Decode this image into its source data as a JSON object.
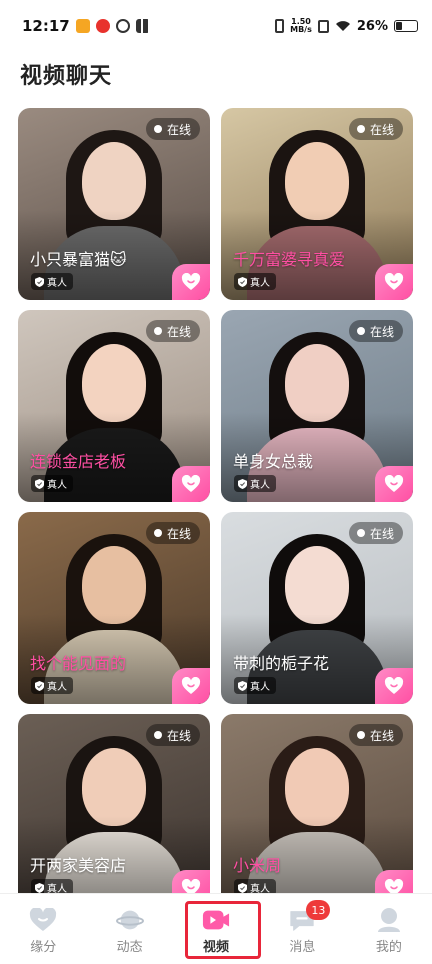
{
  "status_bar": {
    "time": "12:17",
    "net_speed_value": "1.50",
    "net_speed_unit": "MB/s",
    "battery": "26%"
  },
  "page_title": "视频聊天",
  "cards": [
    {
      "name": "小只暴富猫🐱",
      "name_color": "white",
      "status": "在线",
      "verified": "真人",
      "photo": {
        "bg1": "#9a8b80",
        "bg2": "#5a4e47",
        "hair": "#1e1714",
        "skin": "#efd3c2",
        "top": "#6b6b6b"
      }
    },
    {
      "name": "千万富婆寻真爱",
      "name_color": "pink",
      "status": "在线",
      "verified": "真人",
      "photo": {
        "bg1": "#d6c7a4",
        "bg2": "#8f7a58",
        "hair": "#1b1411",
        "skin": "#f1cdb4",
        "top": "#a56b6e"
      }
    },
    {
      "name": "连锁金店老板",
      "name_color": "pink",
      "status": "在线",
      "verified": "真人",
      "photo": {
        "bg1": "#cfc6bd",
        "bg2": "#9c8e82",
        "hair": "#120d0b",
        "skin": "#f3d3c0",
        "top": "#1a1a1a"
      }
    },
    {
      "name": "单身女总裁",
      "name_color": "white",
      "status": "在线",
      "verified": "真人",
      "photo": {
        "bg1": "#9aa6b2",
        "bg2": "#6f7d88",
        "hair": "#140f0e",
        "skin": "#f0cfc4",
        "top": "#e9b9c4"
      }
    },
    {
      "name": "找个能见面的",
      "name_color": "pink",
      "status": "在线",
      "verified": "真人",
      "photo": {
        "bg1": "#8a6a4a",
        "bg2": "#4c3a2a",
        "hair": "#1a120d",
        "skin": "#e7bfa1",
        "top": "#d8cbb4"
      }
    },
    {
      "name": "带刺的栀子花",
      "name_color": "white",
      "status": "在线",
      "verified": "真人",
      "photo": {
        "bg1": "#d9dde0",
        "bg2": "#b7bcc0",
        "hair": "#0f0c0b",
        "skin": "#f4dcd2",
        "top": "#404346"
      }
    },
    {
      "name": "开两家美容店",
      "name_color": "white",
      "status": "在线",
      "verified": "真人",
      "photo": {
        "bg1": "#6b5f55",
        "bg2": "#3e3530",
        "hair": "#1a1411",
        "skin": "#f0cdb8",
        "top": "#e8e2da"
      }
    },
    {
      "name": "小米周",
      "name_color": "pink",
      "status": "在线",
      "verified": "真人",
      "photo": {
        "bg1": "#8b7a6a",
        "bg2": "#5a4a3e",
        "hair": "#2a1c16",
        "skin": "#f1cab5",
        "top": "#c9c3bc"
      }
    }
  ],
  "tabs": [
    {
      "label": "缘分",
      "icon": "heart-icon"
    },
    {
      "label": "动态",
      "icon": "planet-icon"
    },
    {
      "label": "视频",
      "icon": "video-camera-icon"
    },
    {
      "label": "消息",
      "icon": "chat-bubble-icon",
      "badge": "13"
    },
    {
      "label": "我的",
      "icon": "person-icon"
    }
  ],
  "colors": {
    "accent": "#ff4fa3",
    "highlight": "#e8263a",
    "badge": "#ee3a3a"
  }
}
